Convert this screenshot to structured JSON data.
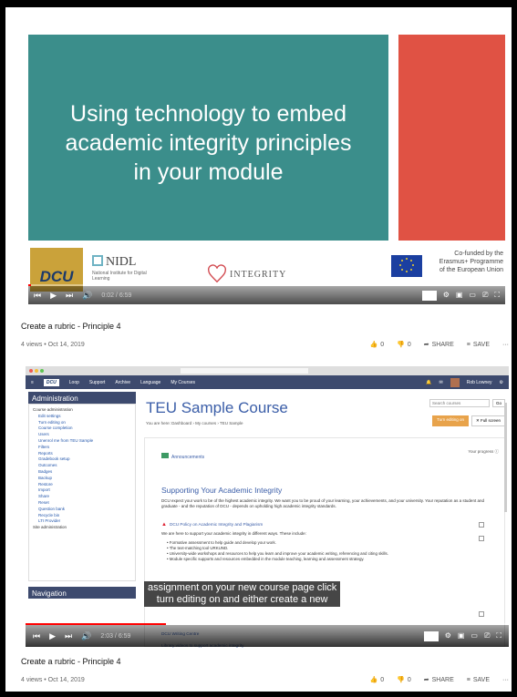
{
  "video1": {
    "slide_title": "Using technology to embed\nacademic integrity principles\nin your module",
    "dcu_logo": "DCU",
    "nidl_name": "NIDL",
    "nidl_sub": "National Institute for Digital Learning",
    "integrity_logo": "INTEGRITY",
    "eu_text": "Co-funded by the\nErasmus+ Programme\nof the European Union",
    "time": "0:02 / 6:59",
    "progress": 0.005
  },
  "video1_meta": {
    "title": "Create a rubric - Principle 4",
    "views_date": "4 views • Oct 14, 2019",
    "likes": "0",
    "dislikes": "0",
    "share": "SHARE",
    "save": "SAVE",
    "more": "···"
  },
  "video2": {
    "nav": {
      "logo": "DCU",
      "items": [
        "Loop",
        "Support",
        "Archive",
        "Language",
        "My Courses"
      ],
      "user": "Rob Lowney"
    },
    "admin_title": "Administration",
    "admin_items": [
      "Course administration",
      "Edit settings",
      "Turn editing on",
      "Course completion",
      "Users",
      "Unenrol me from TEU Sample",
      "Filters",
      "Reports",
      "Gradebook setup",
      "Outcomes",
      "Badges",
      "Backup",
      "Restore",
      "Import",
      "Share",
      "Reset",
      "Question bank",
      "Recycle bin",
      "LTI Provider",
      "Site administration"
    ],
    "navigation_title": "Navigation",
    "course_title": "TEU Sample Course",
    "breadcrumb": "You are here: Dashboard › My courses › TEU Sample",
    "search_placeholder": "Search courses",
    "go": "Go",
    "turn_editing_on": "Turn editing on",
    "full_screen": "✕ Full screen",
    "announcements": "Announcements",
    "your_progress": "Your progress ⓘ",
    "section_title": "Supporting Your Academic Integrity",
    "body_text": "DCU expect your work to be of the highest academic integrity. We want you to be proud of your learning, your achievements, and your university. Your reputation as a student and graduate - and the reputation of DCU - depends on upholding high academic integrity standards.",
    "policy_link": "DCU Policy on Academic Integrity and Plagiarism",
    "support_line": "We are here to support your academic integrity in different ways. These include:",
    "bullets": [
      "Formative assessment to help guide and develop your work.",
      "The text-matching tool URKUND.",
      "University-wide workshops and resources to help you learn and improve your academic writing, referencing and citing skills.",
      "Module specific supports and resources embedded in the module teaching, learning and assessment strategy."
    ],
    "link_writing": "DCU Writing Centre",
    "link_library": "Library videos to support academic integrity",
    "caption": "assignment on your new course page click\nturn editing on and either create a new",
    "time": "2:03 / 6:59",
    "progress": 0.29
  },
  "video2_meta": {
    "title": "Create a rubric - Principle 4",
    "views_date": "4 views • Oct 14, 2019",
    "likes": "0",
    "dislikes": "0",
    "share": "SHARE",
    "save": "SAVE",
    "more": "···"
  },
  "icons": {
    "prev": "prev-icon",
    "play": "play-icon",
    "next": "next-icon",
    "volume": "volume-icon",
    "settings": "settings-icon",
    "miniplayer": "miniplayer-icon",
    "theater": "theater-icon",
    "cast": "cast-icon",
    "fullscreen": "fullscreen-icon"
  },
  "colors": {
    "slide_teal": "#3b8e8b",
    "slide_red": "#e05244",
    "progress_red": "#ff0000",
    "moodle_blue": "#3d4a6e"
  }
}
